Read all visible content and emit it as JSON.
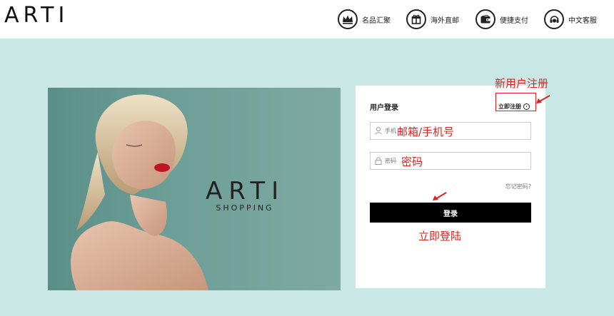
{
  "header": {
    "logo": "ARTI",
    "services": [
      {
        "label": "名品汇聚",
        "icon": "crown-icon"
      },
      {
        "label": "海外直邮",
        "icon": "gift-icon"
      },
      {
        "label": "便捷支付",
        "icon": "wallet-icon"
      },
      {
        "label": "中文客服",
        "icon": "headset-icon"
      }
    ]
  },
  "hero": {
    "brand": "ARTI",
    "subtitle": "SHOPPING"
  },
  "login": {
    "title": "用户登录",
    "register_link": "立即注册",
    "username_placeholder": "手机",
    "password_placeholder": "密码",
    "forgot": "忘记密码?",
    "submit": "登录"
  },
  "annotations": {
    "new_user": "新用户注册",
    "email_phone": "邮箱/手机号",
    "password": "密码",
    "login_now": "立即登陆"
  },
  "colors": {
    "background": "#c9e7e4",
    "annotation": "#e0201c",
    "button": "#000000"
  }
}
